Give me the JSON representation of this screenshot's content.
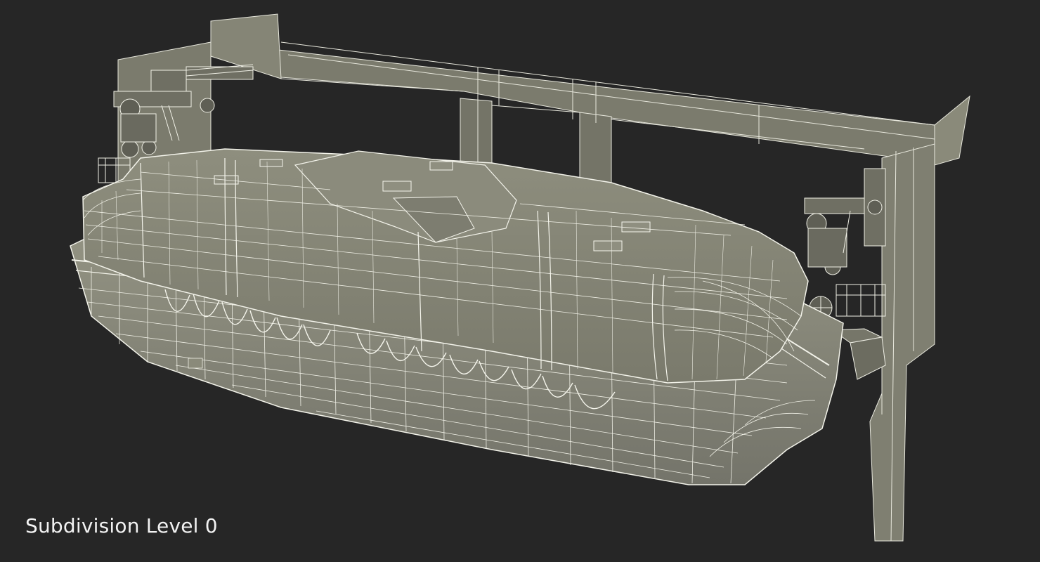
{
  "caption": "Subdivision Level 0",
  "colors": {
    "background": "#262626",
    "surface": "#838373",
    "surface_dark": "#6c6c5e",
    "surface_light": "#9a9a88",
    "wire": "#f3f3ea",
    "caption_text": "#f2f2f2"
  }
}
